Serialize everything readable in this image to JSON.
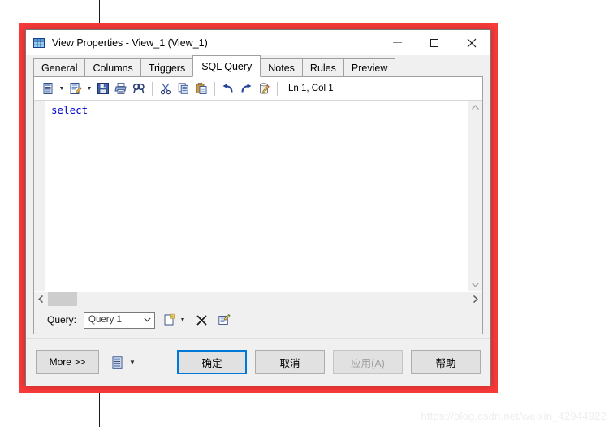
{
  "window": {
    "title": "View Properties - View_1 (View_1)",
    "icon": "table-view-icon",
    "controls": {
      "minimize": "minimize-icon",
      "maximize": "maximize-icon",
      "close": "close-icon"
    }
  },
  "tabs": [
    {
      "label": "General",
      "active": false
    },
    {
      "label": "Columns",
      "active": false
    },
    {
      "label": "Triggers",
      "active": false
    },
    {
      "label": "SQL Query",
      "active": true
    },
    {
      "label": "Notes",
      "active": false
    },
    {
      "label": "Rules",
      "active": false
    },
    {
      "label": "Preview",
      "active": false
    }
  ],
  "editor_toolbar": {
    "buttons": [
      {
        "name": "load-script-icon",
        "has_dropdown": true
      },
      {
        "name": "edit-script-icon",
        "has_dropdown": true
      },
      {
        "name": "save-icon",
        "has_dropdown": false
      },
      {
        "name": "print-icon",
        "has_dropdown": false
      },
      {
        "name": "find-icon",
        "has_dropdown": false
      },
      {
        "name": "cut-icon",
        "has_dropdown": false
      },
      {
        "name": "copy-icon",
        "has_dropdown": false
      },
      {
        "name": "paste-icon",
        "has_dropdown": false
      },
      {
        "name": "undo-icon",
        "has_dropdown": false
      },
      {
        "name": "redo-icon",
        "has_dropdown": false
      },
      {
        "name": "clear-icon",
        "has_dropdown": false
      }
    ],
    "status": "Ln 1, Col 1"
  },
  "editor": {
    "content": "select",
    "scroll": {
      "vertical_up": "▲",
      "vertical_down": "▼",
      "horizontal_left": "◄",
      "horizontal_right": "►"
    }
  },
  "query_bar": {
    "label": "Query:",
    "combo_value": "Query 1",
    "combo_options": [
      "Query 1"
    ],
    "new_query_icon": "new-query-icon",
    "new_query_dropdown": "chevron-down-icon",
    "delete_query_icon": "delete-query-icon",
    "properties_icon": "query-properties-icon"
  },
  "footer": {
    "more_label": "More >>",
    "script_icon": "script-options-icon",
    "script_dropdown": "chevron-down-icon",
    "ok_label": "确定",
    "cancel_label": "取消",
    "apply_label": "应用(A)",
    "apply_disabled": true,
    "help_label": "帮助"
  },
  "annotation": {
    "highlight_color": "#f93a3a",
    "guide_line_color": "#1a1a1a"
  },
  "watermark": {
    "text": "https://blog.csdn.net/weixin_42944922"
  }
}
